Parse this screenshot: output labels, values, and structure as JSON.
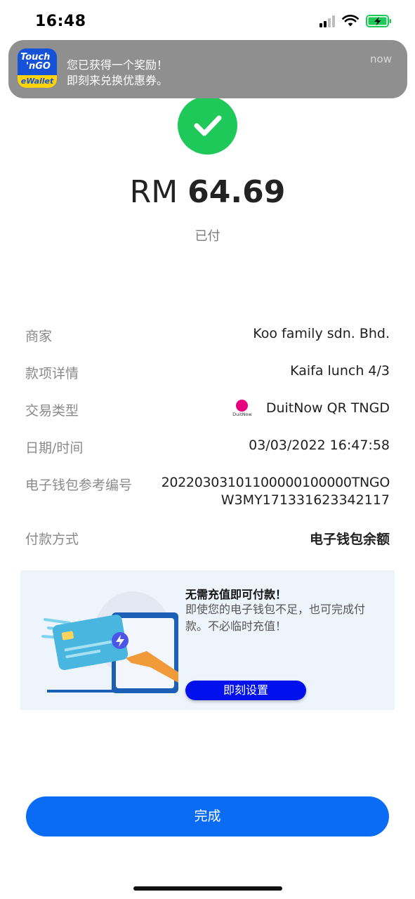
{
  "status_bar": {
    "time": "16:48"
  },
  "notification": {
    "app_logo_lines": [
      "Touch",
      "'nGO",
      "eWallet"
    ],
    "title": "您已获得一个奖励！",
    "body": "即刻来兑换优惠券。",
    "time": "now"
  },
  "payment": {
    "currency": "RM",
    "amount": "64.69",
    "status": "已付"
  },
  "details": {
    "merchant_label": "商家",
    "merchant_value": "Koo family sdn. Bhd.",
    "item_label": "款项详情",
    "item_value": "Kaifa lunch 4/3",
    "type_label": "交易类型",
    "type_logo_text": "DuitNow",
    "type_value": "DuitNow QR TNGD",
    "datetime_label": "日期/时间",
    "datetime_value": "03/03/2022 16:47:58",
    "ref_label": "电子钱包参考编号",
    "ref_value_line1": "20220303101100000100000TNGO",
    "ref_value_line2": "W3MY171331623342117",
    "method_label": "付款方式",
    "method_value": "电子钱包余额"
  },
  "promo": {
    "title": "无需充值即可付款！",
    "body": "即使您的电子钱包不足，也可完成付款。不必临时充值！",
    "button": "即刻设置"
  },
  "done_button": "完成",
  "colors": {
    "success": "#1ec95a",
    "primary": "#0a6cf5",
    "promo_button": "#0011ee",
    "promo_bg": "#eef4fb",
    "duitnow_pink": "#e6007e"
  }
}
